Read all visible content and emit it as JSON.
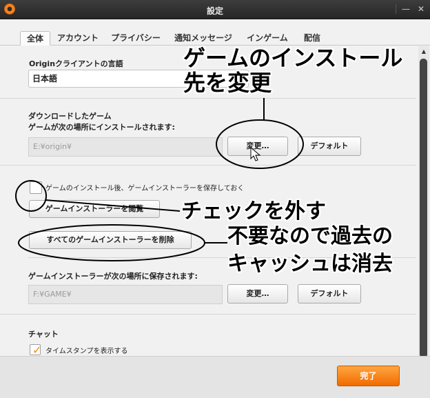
{
  "window": {
    "title": "設定"
  },
  "tabs": [
    "全体",
    "アカウント",
    "プライバシー",
    "通知メッセージ",
    "インゲーム",
    "配信"
  ],
  "language": {
    "label": "Originクライアントの言語",
    "value": "日本語"
  },
  "download": {
    "title": "ダウンロードしたゲーム",
    "subtitle": "ゲームが次の場所にインストールされます:",
    "path": "E:¥origin¥",
    "change_label": "変更…",
    "default_label": "デフォルト"
  },
  "installer": {
    "checkbox_label": "ゲームのインストール後、ゲームインストーラーを保存しておく",
    "view_label": "ゲームインストーラーを閲覧",
    "delete_label": "すべてのゲームインストーラーを削除",
    "save_location_label": "ゲームインストーラーが次の場所に保存されます:",
    "path": "F:¥GAME¥",
    "change_label": "変更…",
    "default_label": "デフォルト"
  },
  "chat": {
    "title": "チャット",
    "timestamp_label": "タイムスタンプを表示する"
  },
  "footer": {
    "done_label": "完了"
  },
  "annotations": {
    "change_location": [
      "ゲームのインストール",
      "先を変更"
    ],
    "uncheck": "チェックを外す",
    "clear_cache": [
      "不要なので過去の",
      "キャッシュは消去"
    ]
  },
  "colors": {
    "accent": "#f5821f",
    "done_button": "#f07d10"
  }
}
